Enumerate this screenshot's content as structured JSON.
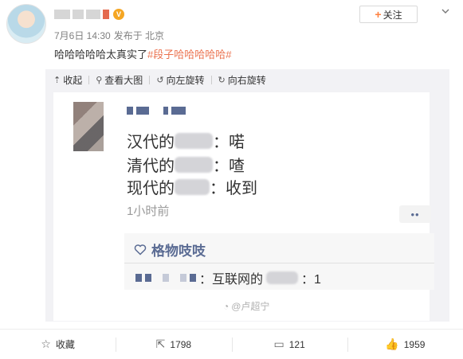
{
  "post": {
    "date": "7月6日 14:30",
    "source": "发布于 北京",
    "text_prefix": "哈哈哈哈哈太真实了",
    "topic": "#段子哈哈哈哈哈#",
    "follow_label": "关注"
  },
  "media_toolbar": {
    "collapse": "收起",
    "view_large": "查看大图",
    "rotate_left": "向左旋转",
    "rotate_right": "向右旋转"
  },
  "screenshot": {
    "line1_prefix": "汉代的",
    "line1_suffix": "：喏",
    "line2_prefix": "清代的",
    "line2_suffix": "：喳",
    "line3_prefix": "现代的",
    "line3_suffix": "：收到",
    "time": "1小时前",
    "more": "••",
    "group_name": "格物吱吱",
    "group_row_label": "：互联网的",
    "group_row_suffix": "：1",
    "watermark": "@卢超宁"
  },
  "actions": {
    "favorite": "收藏",
    "repost_count": "1798",
    "comment_count": "121",
    "like_count": "1959"
  }
}
